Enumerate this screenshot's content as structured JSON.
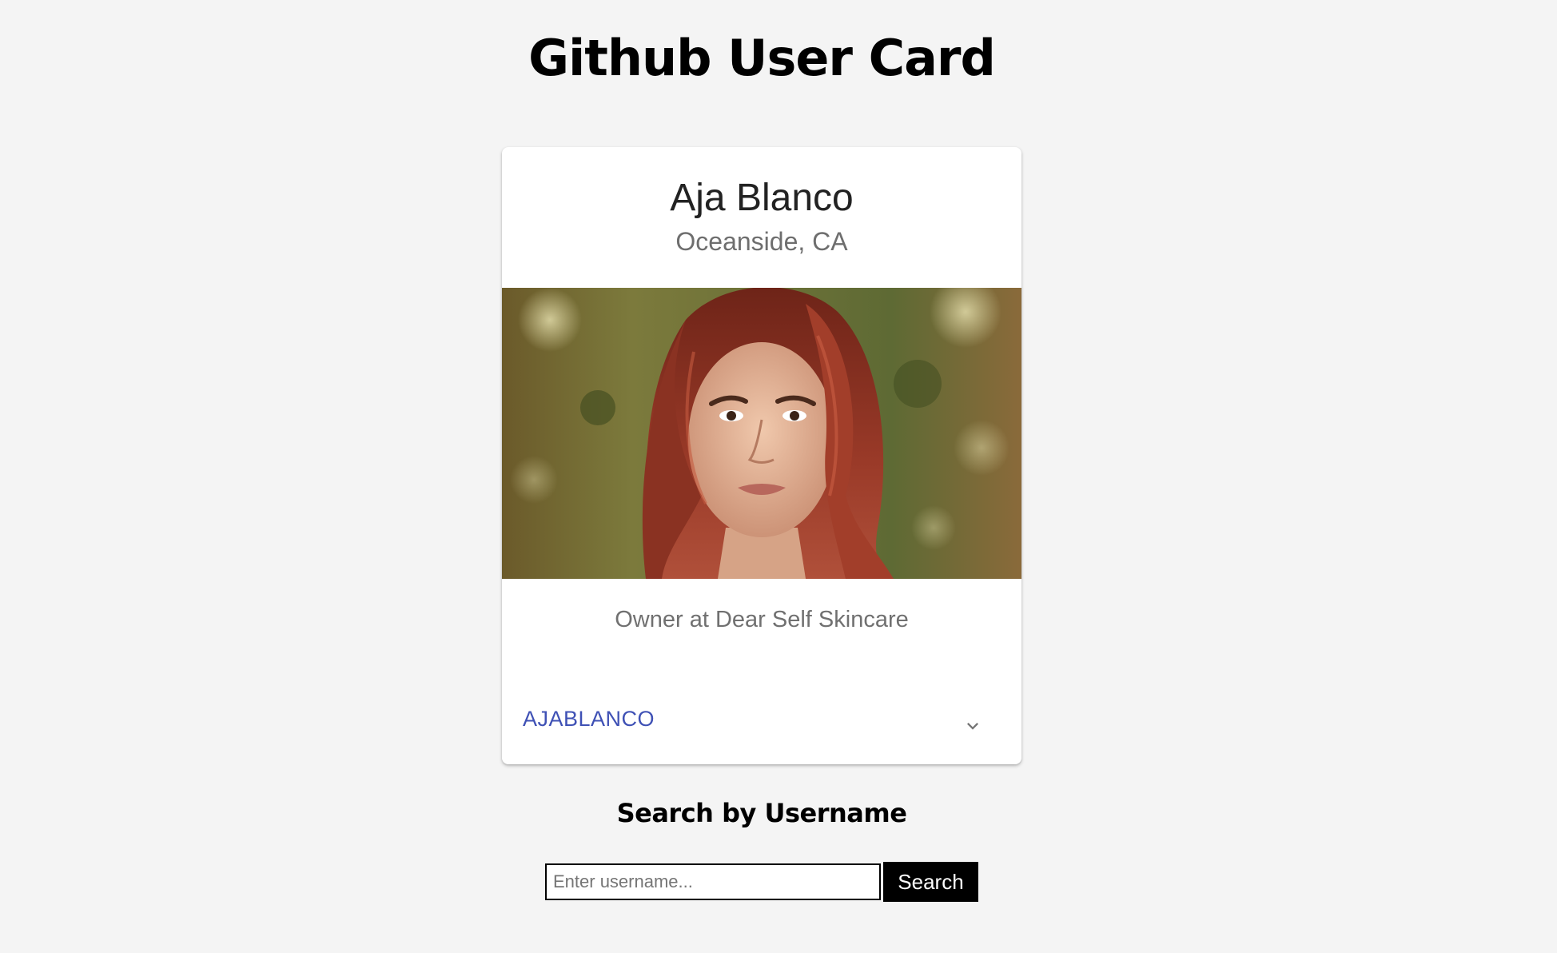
{
  "page": {
    "title": "Github User Card"
  },
  "card": {
    "name": "Aja Blanco",
    "location": "Oceanside, CA",
    "bio": "Owner at Dear Self Skincare",
    "username": "AJABLANCO",
    "expand_icon": "chevron-down-icon",
    "photo_icon": "user-avatar-photo"
  },
  "search": {
    "heading": "Search by Username",
    "placeholder": "Enter username...",
    "value": "",
    "button_label": "Search"
  },
  "colors": {
    "background": "#f4f4f4",
    "card": "#ffffff",
    "link": "#3f51b5",
    "secondary_text": "#707070",
    "button": "#000000"
  }
}
